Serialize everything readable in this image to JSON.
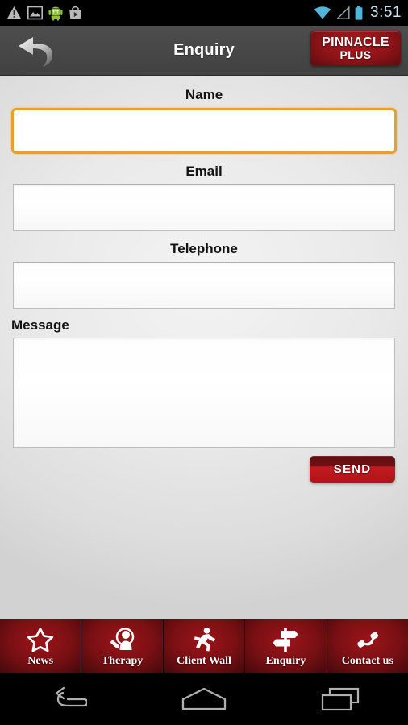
{
  "status_bar": {
    "icons_left": [
      "warning-triangle-icon",
      "image-icon",
      "android-robot-icon",
      "play-store-icon"
    ],
    "icons_right": [
      "wifi-icon",
      "cell-signal-icon",
      "battery-icon"
    ],
    "time": "3:51",
    "accent_color": "#52b5d8",
    "background": "#000000"
  },
  "header": {
    "back_icon": "curved-back-arrow-icon",
    "title": "Enquiry",
    "logo": {
      "line1": "PINNACLE",
      "line2": "PLUS"
    },
    "background": "#474747",
    "logo_color": "#8e1418"
  },
  "form": {
    "fields": [
      {
        "label": "Name",
        "value": "",
        "placeholder": "",
        "focused": true,
        "type": "text"
      },
      {
        "label": "Email",
        "value": "",
        "placeholder": "",
        "focused": false,
        "type": "email"
      },
      {
        "label": "Telephone",
        "value": "",
        "placeholder": "",
        "focused": false,
        "type": "tel"
      },
      {
        "label": "Message",
        "value": "",
        "placeholder": "",
        "focused": false,
        "type": "textarea"
      }
    ],
    "send_label": "SEND",
    "focus_color": "#e5a034",
    "send_color": "#b01519"
  },
  "tabbar": {
    "items": [
      {
        "label": "News",
        "icon": "star-icon",
        "active": false
      },
      {
        "label": "Therapy",
        "icon": "person-search-icon",
        "active": false
      },
      {
        "label": "Client Wall",
        "icon": "running-person-icon",
        "active": false
      },
      {
        "label": "Enquiry",
        "icon": "signpost-icon",
        "active": true
      },
      {
        "label": "Contact us",
        "icon": "phone-icon",
        "active": false
      }
    ],
    "background": "#7a1014"
  },
  "navbar": {
    "buttons": [
      {
        "name": "back",
        "icon": "nav-back-icon"
      },
      {
        "name": "home",
        "icon": "nav-home-icon"
      },
      {
        "name": "recents",
        "icon": "nav-recents-icon"
      }
    ],
    "background": "#000000"
  }
}
